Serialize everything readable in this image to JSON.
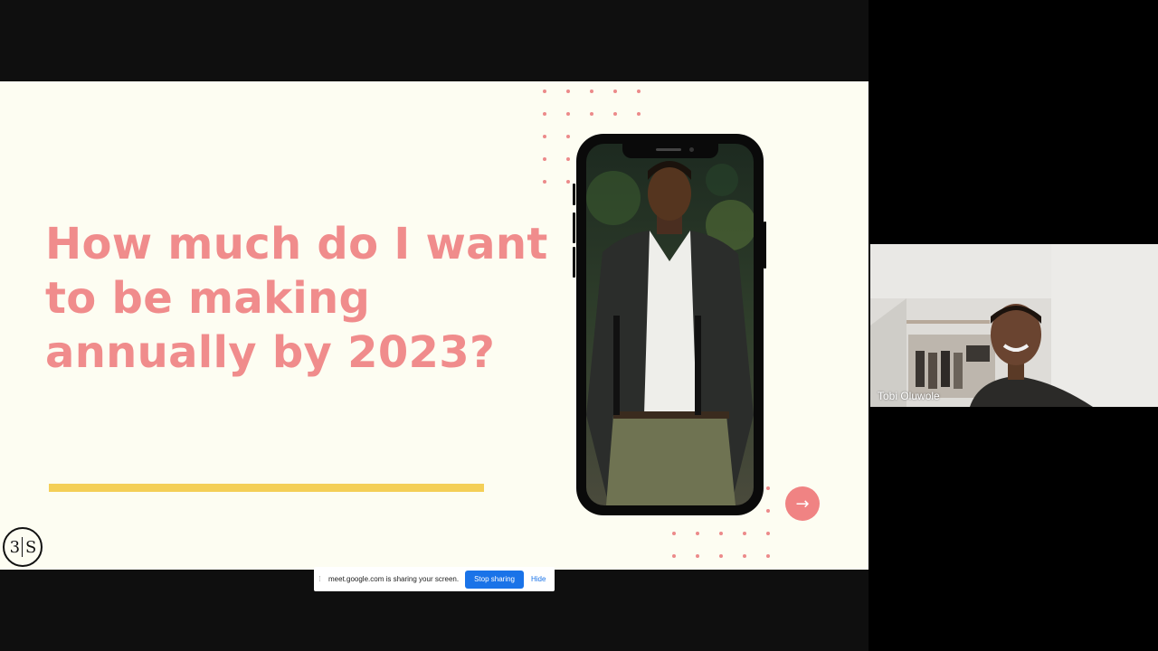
{
  "slide": {
    "headline": "How much do I want to be making annually by 2023?",
    "logo": {
      "left": "3",
      "right": "S"
    },
    "next_icon": "→"
  },
  "share_bar": {
    "message": "meet.google.com is sharing your screen.",
    "stop_label": "Stop sharing",
    "hide_label": "Hide"
  },
  "participant": {
    "name": "Tobi Oluwole"
  },
  "colors": {
    "headline": "#f08c8c",
    "accent_bar": "#f4cf57",
    "slide_bg": "#fdfdf2",
    "button": "#1a73e8"
  }
}
